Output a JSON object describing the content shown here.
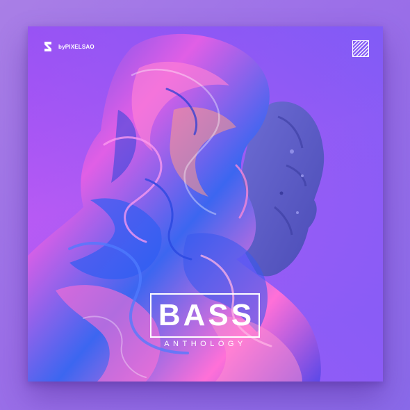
{
  "cover": {
    "brand_text": "byPIXELSAO",
    "title": "BASS",
    "subtitle": "ANTHOLOGY"
  },
  "icons": {
    "brand_logo": "pixelsao-logo",
    "corner": "diagonal-stripes-icon"
  },
  "colors": {
    "background": "#9b6fe8",
    "cover_top": "#c04bf0",
    "cover_bottom": "#9a5cf5",
    "swirl_blue": "#3a5cf0",
    "swirl_pink": "#ff5fd8",
    "swirl_orange": "#ff9a8a",
    "stone": "#5c5dc4",
    "text": "#ffffff"
  }
}
